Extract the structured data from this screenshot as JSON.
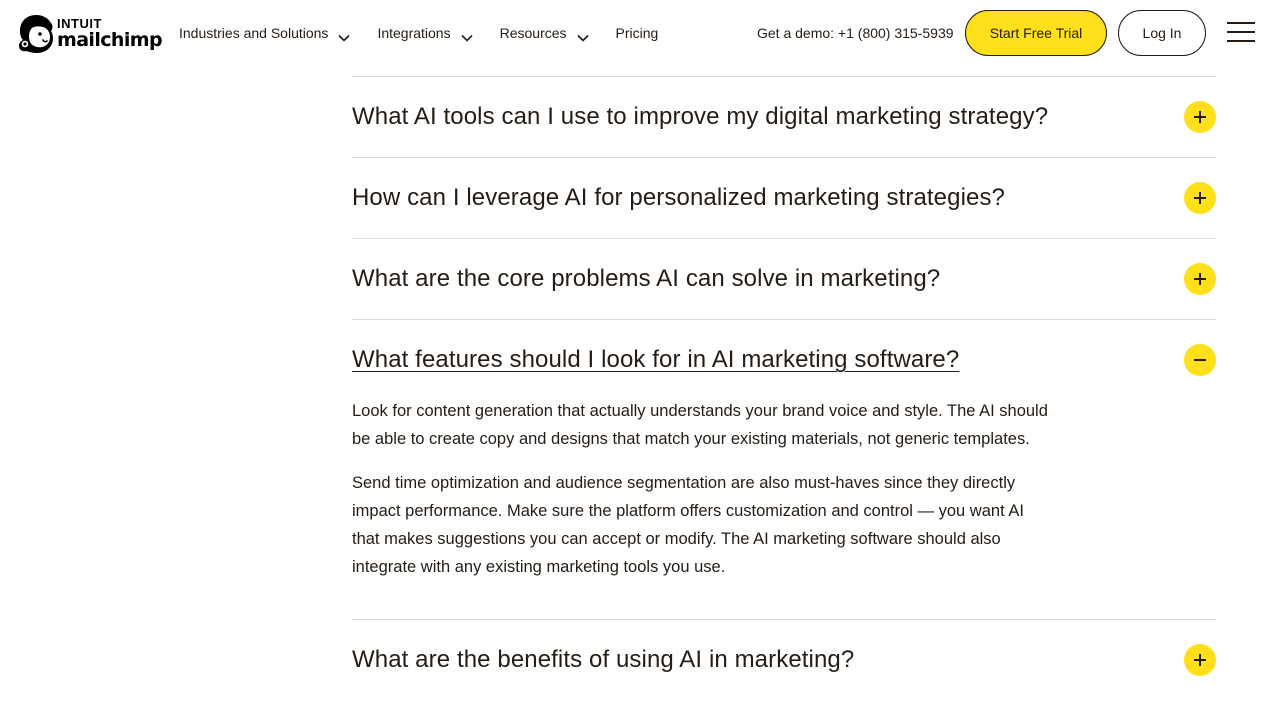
{
  "header": {
    "logo": {
      "top_text": "INTUIT",
      "bottom_text": "mailchimp",
      "icon": "freddie-chimp-icon"
    },
    "nav": [
      {
        "label": "Industries and Solutions",
        "has_dropdown": true
      },
      {
        "label": "Integrations",
        "has_dropdown": true
      },
      {
        "label": "Resources",
        "has_dropdown": true
      },
      {
        "label": "Pricing",
        "has_dropdown": false
      }
    ],
    "demo_text": "Get a demo: +1 (800) 315-5939",
    "trial_label": "Start Free Trial",
    "login_label": "Log In",
    "menu_icon": "hamburger-icon"
  },
  "faq": {
    "items": [
      {
        "question": "What AI tools can I use to improve my digital marketing strategy?",
        "open": false
      },
      {
        "question": "How can I leverage AI for personalized marketing strategies?",
        "open": false
      },
      {
        "question": "What are the core problems AI can solve in marketing?",
        "open": false
      },
      {
        "question": "What features should I look for in AI marketing software?",
        "open": true,
        "answer": [
          "Look for content generation that actually understands your brand voice and style. The AI should be able to create copy and designs that match your existing materials, not generic templates.",
          "Send time optimization and audience segmentation are also must-haves since they directly impact performance. Make sure the platform offers customization and control — you want AI that makes suggestions you can accept or modify. The AI marketing software should also integrate with any existing marketing tools you use."
        ]
      },
      {
        "question": "What are the benefits of using AI in marketing?",
        "open": false
      }
    ]
  },
  "colors": {
    "brand_yellow": "#ffe01b",
    "text": "#241c15",
    "divider": "#d9d9d9"
  }
}
